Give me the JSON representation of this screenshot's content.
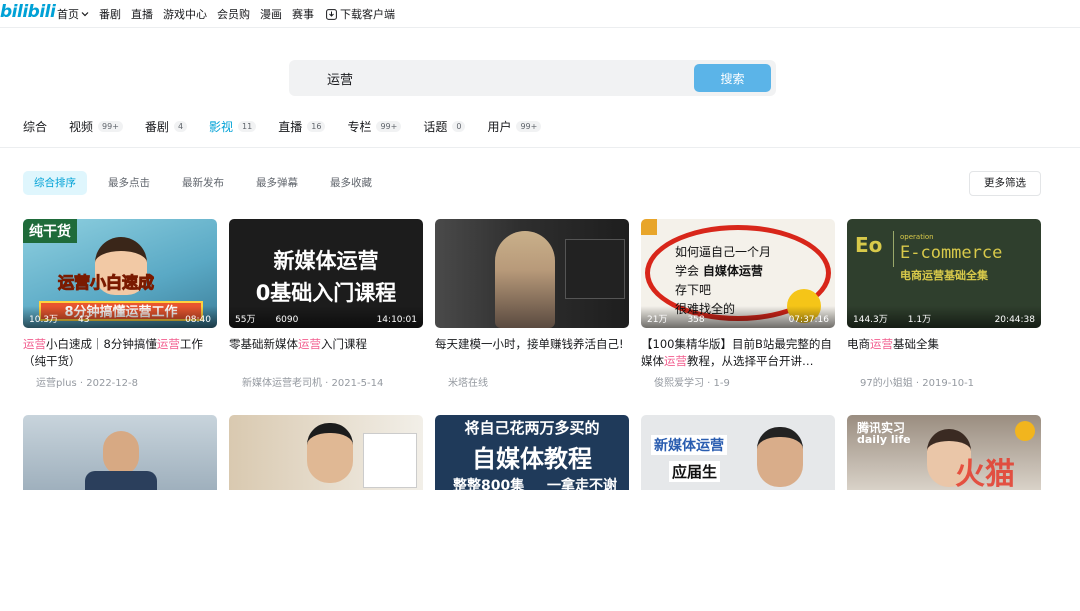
{
  "header": {
    "logo": "bilibili",
    "nav": [
      "首页",
      "番剧",
      "直播",
      "游戏中心",
      "会员购",
      "漫画",
      "赛事"
    ],
    "download": "下载客户端"
  },
  "search": {
    "query": "运营",
    "button": "搜索"
  },
  "tabs": [
    {
      "label": "综合",
      "count": ""
    },
    {
      "label": "视频",
      "count": "99+"
    },
    {
      "label": "番剧",
      "count": "4"
    },
    {
      "label": "影视",
      "count": "11"
    },
    {
      "label": "直播",
      "count": "16"
    },
    {
      "label": "专栏",
      "count": "99+"
    },
    {
      "label": "话题",
      "count": "0"
    },
    {
      "label": "用户",
      "count": "99+"
    }
  ],
  "filters": [
    "综合排序",
    "最多点击",
    "最新发布",
    "最多弹幕",
    "最多收藏"
  ],
  "more_filter": "更多筛选",
  "videos": [
    {
      "views": "10.3万",
      "danmaku": "43",
      "duration": "08:40",
      "title_parts": [
        "运营",
        "小白速成｜8分钟搞懂",
        "运营",
        "工作（纯干货）"
      ],
      "author": "运营plus",
      "date": "2022-12-8",
      "thumb_text": [
        "纯干货",
        "运营小白速成",
        "8分钟搞懂运营工作"
      ]
    },
    {
      "views": "55万",
      "danmaku": "6090",
      "duration": "14:10:01",
      "title_parts": [
        "零基础新媒体",
        "运营",
        "入门课程"
      ],
      "author": "新媒体运营老司机",
      "date": "2021-5-14",
      "thumb_text": [
        "新媒体运营",
        "0基础入门课程"
      ]
    },
    {
      "views": "",
      "danmaku": "",
      "duration": "",
      "title_parts": [
        "每天建模一小时，接单赚钱养活自己!"
      ],
      "author": "米塔在线",
      "date": "",
      "thumb_text": []
    },
    {
      "views": "21万",
      "danmaku": "358",
      "duration": "07:37:16",
      "title_parts": [
        "【100集精华版】目前B站最完整的自媒体",
        "运营",
        "教程，从选择平台开讲…"
      ],
      "author": "俊熙爱学习",
      "date": "1-9",
      "thumb_text": [
        "如何逼自己一个月",
        "学会",
        "自媒体运营",
        "存下吧",
        "很难找全的"
      ]
    },
    {
      "views": "144.3万",
      "danmaku": "1.1万",
      "duration": "20:44:38",
      "title_parts": [
        "电商",
        "运营",
        "基础全集"
      ],
      "author": "97的小姐姐",
      "date": "2019-10-1",
      "thumb_text": [
        "Eo",
        "operation",
        "E-commerce",
        "电商运营基础全集"
      ]
    }
  ],
  "row2_thumbs": [
    {
      "text": []
    },
    {
      "text": []
    },
    {
      "text": [
        "将自己花两万多买的",
        "自媒体教程",
        "整整800集",
        "一拿走不谢"
      ]
    },
    {
      "text": [
        "新媒体运营",
        "应届生"
      ]
    },
    {
      "text": [
        "腾讯实习",
        "daily life"
      ]
    }
  ],
  "watermark": "火猫鱼"
}
